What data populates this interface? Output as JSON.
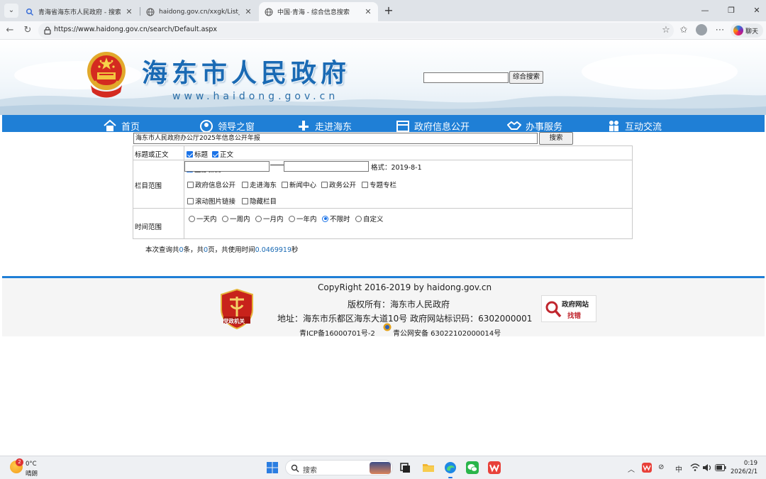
{
  "browser": {
    "tabs": [
      {
        "label": "青海省海东市人民政府 - 搜索",
        "active": false
      },
      {
        "label": "haidong.gov.cn/xxgk/List_wj.aspx?",
        "active": false
      },
      {
        "label": "中国·青海 - 综合信息搜索",
        "active": true
      }
    ],
    "url": "https://www.haidong.gov.cn/search/Default.aspx",
    "copilot_label": "聊天"
  },
  "header": {
    "title": "海东市人民政府",
    "domain": "www.haidong.gov.cn",
    "search_value": "",
    "search_button": "综合搜索"
  },
  "nav": {
    "items": [
      {
        "label": "首页",
        "icon": "home-icon"
      },
      {
        "label": "领导之窗",
        "icon": "leader-icon"
      },
      {
        "label": "走进海东",
        "icon": "building-icon"
      },
      {
        "label": "政府信息公开",
        "icon": "calendar-icon"
      },
      {
        "label": "办事服务",
        "icon": "handshake-icon"
      },
      {
        "label": "互动交流",
        "icon": "people-icon"
      }
    ]
  },
  "search": {
    "keyword": "海东市人民政府办公厅2025年信息公开年报",
    "button": "搜索",
    "rows": {
      "title_or_body": {
        "label": "标题或正文",
        "options": [
          {
            "label": "标题",
            "checked": true
          },
          {
            "label": "正文",
            "checked": true
          }
        ]
      },
      "scope": {
        "label": "栏目范围",
        "all": {
          "label": "全部栏目",
          "checked": true
        },
        "options_row1": [
          {
            "label": "政府信息公开",
            "checked": false
          },
          {
            "label": "走进海东",
            "checked": false
          },
          {
            "label": "新闻中心",
            "checked": false
          },
          {
            "label": "政务公开",
            "checked": false
          },
          {
            "label": "专题专栏",
            "checked": false
          }
        ],
        "options_row2": [
          {
            "label": "滚动图片链接",
            "checked": false
          },
          {
            "label": "隐藏栏目",
            "checked": false
          }
        ]
      },
      "time": {
        "label": "时间范围",
        "options": [
          {
            "label": "一天内",
            "checked": false
          },
          {
            "label": "一周内",
            "checked": false
          },
          {
            "label": "一月内",
            "checked": false
          },
          {
            "label": "一年内",
            "checked": false
          },
          {
            "label": "不限时",
            "checked": true
          },
          {
            "label": "自定义",
            "checked": false
          }
        ],
        "start_value": "",
        "end_value": "",
        "format_text": "格式：2019-8-1"
      }
    },
    "result": {
      "prefix": "本次查询共",
      "count": "0",
      "mid1": "条，共",
      "pages": "0",
      "mid2": "页，共使用时间",
      "time": "0.0469919",
      "suffix": "秒"
    }
  },
  "footer": {
    "copyright": "CopyRight 2016-2019 by haidong.gov.cn",
    "owner": "版权所有：海东市人民政府",
    "address": "地址：海东市乐都区海东大道10号  政府网站标识码：6302000001",
    "icp": "青ICP备16000701号-2",
    "police": "青公网安备 63022102000014号",
    "badge_left_label": "党政机关",
    "badge_right_line1": "政府网站",
    "badge_right_line2": "找错"
  },
  "taskbar": {
    "weather_temp": "0°C",
    "weather_desc": "晴朗",
    "weather_badge": "2",
    "search_label": "搜索",
    "ime": "中",
    "time": "0:19",
    "date": "2026/2/1"
  }
}
